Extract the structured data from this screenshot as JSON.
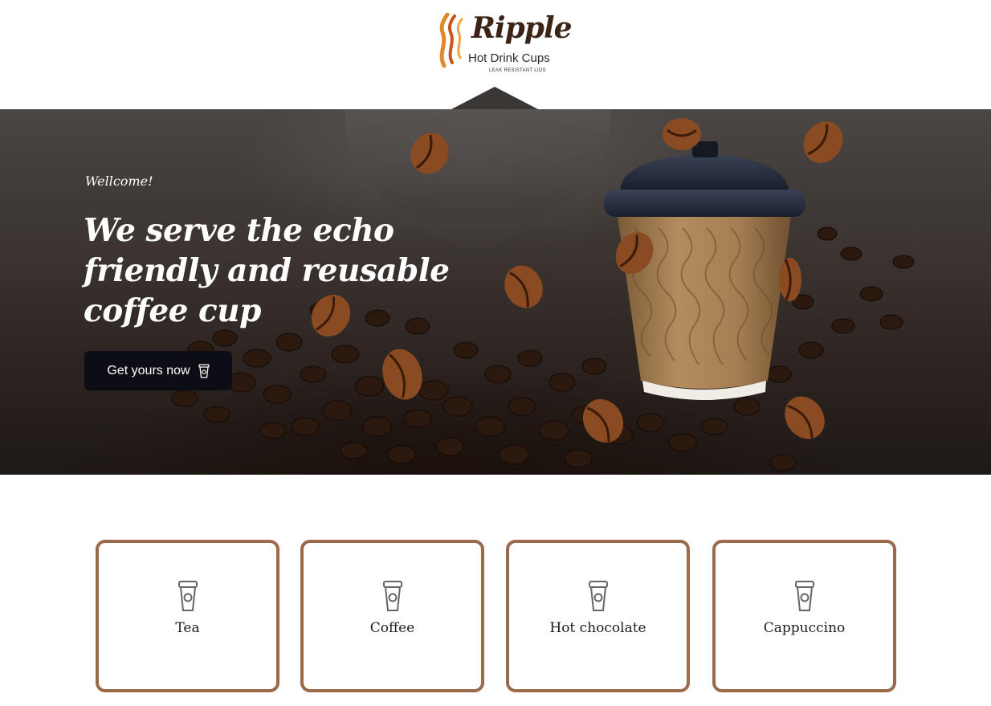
{
  "logo": {
    "brand": "Ripple",
    "subtitle": "Hot Drink Cups",
    "tagline": "LEAK RESISTANT LIDS",
    "icon": "steam-logo-icon"
  },
  "hero": {
    "welcome": "Wellcome!",
    "title": "We serve the echo friendly and reusable coffee cup",
    "cta_label": "Get yours now",
    "cta_icon": "cup-icon"
  },
  "categories": [
    {
      "label": "Tea",
      "icon": "cup-icon"
    },
    {
      "label": "Coffee",
      "icon": "cup-icon"
    },
    {
      "label": "Hot chocolate",
      "icon": "cup-icon"
    },
    {
      "label": "Cappuccino",
      "icon": "cup-icon"
    }
  ],
  "colors": {
    "card_border": "#9b6a4a",
    "button_bg": "#0d0d15",
    "hero_bg": "#3d3633"
  }
}
